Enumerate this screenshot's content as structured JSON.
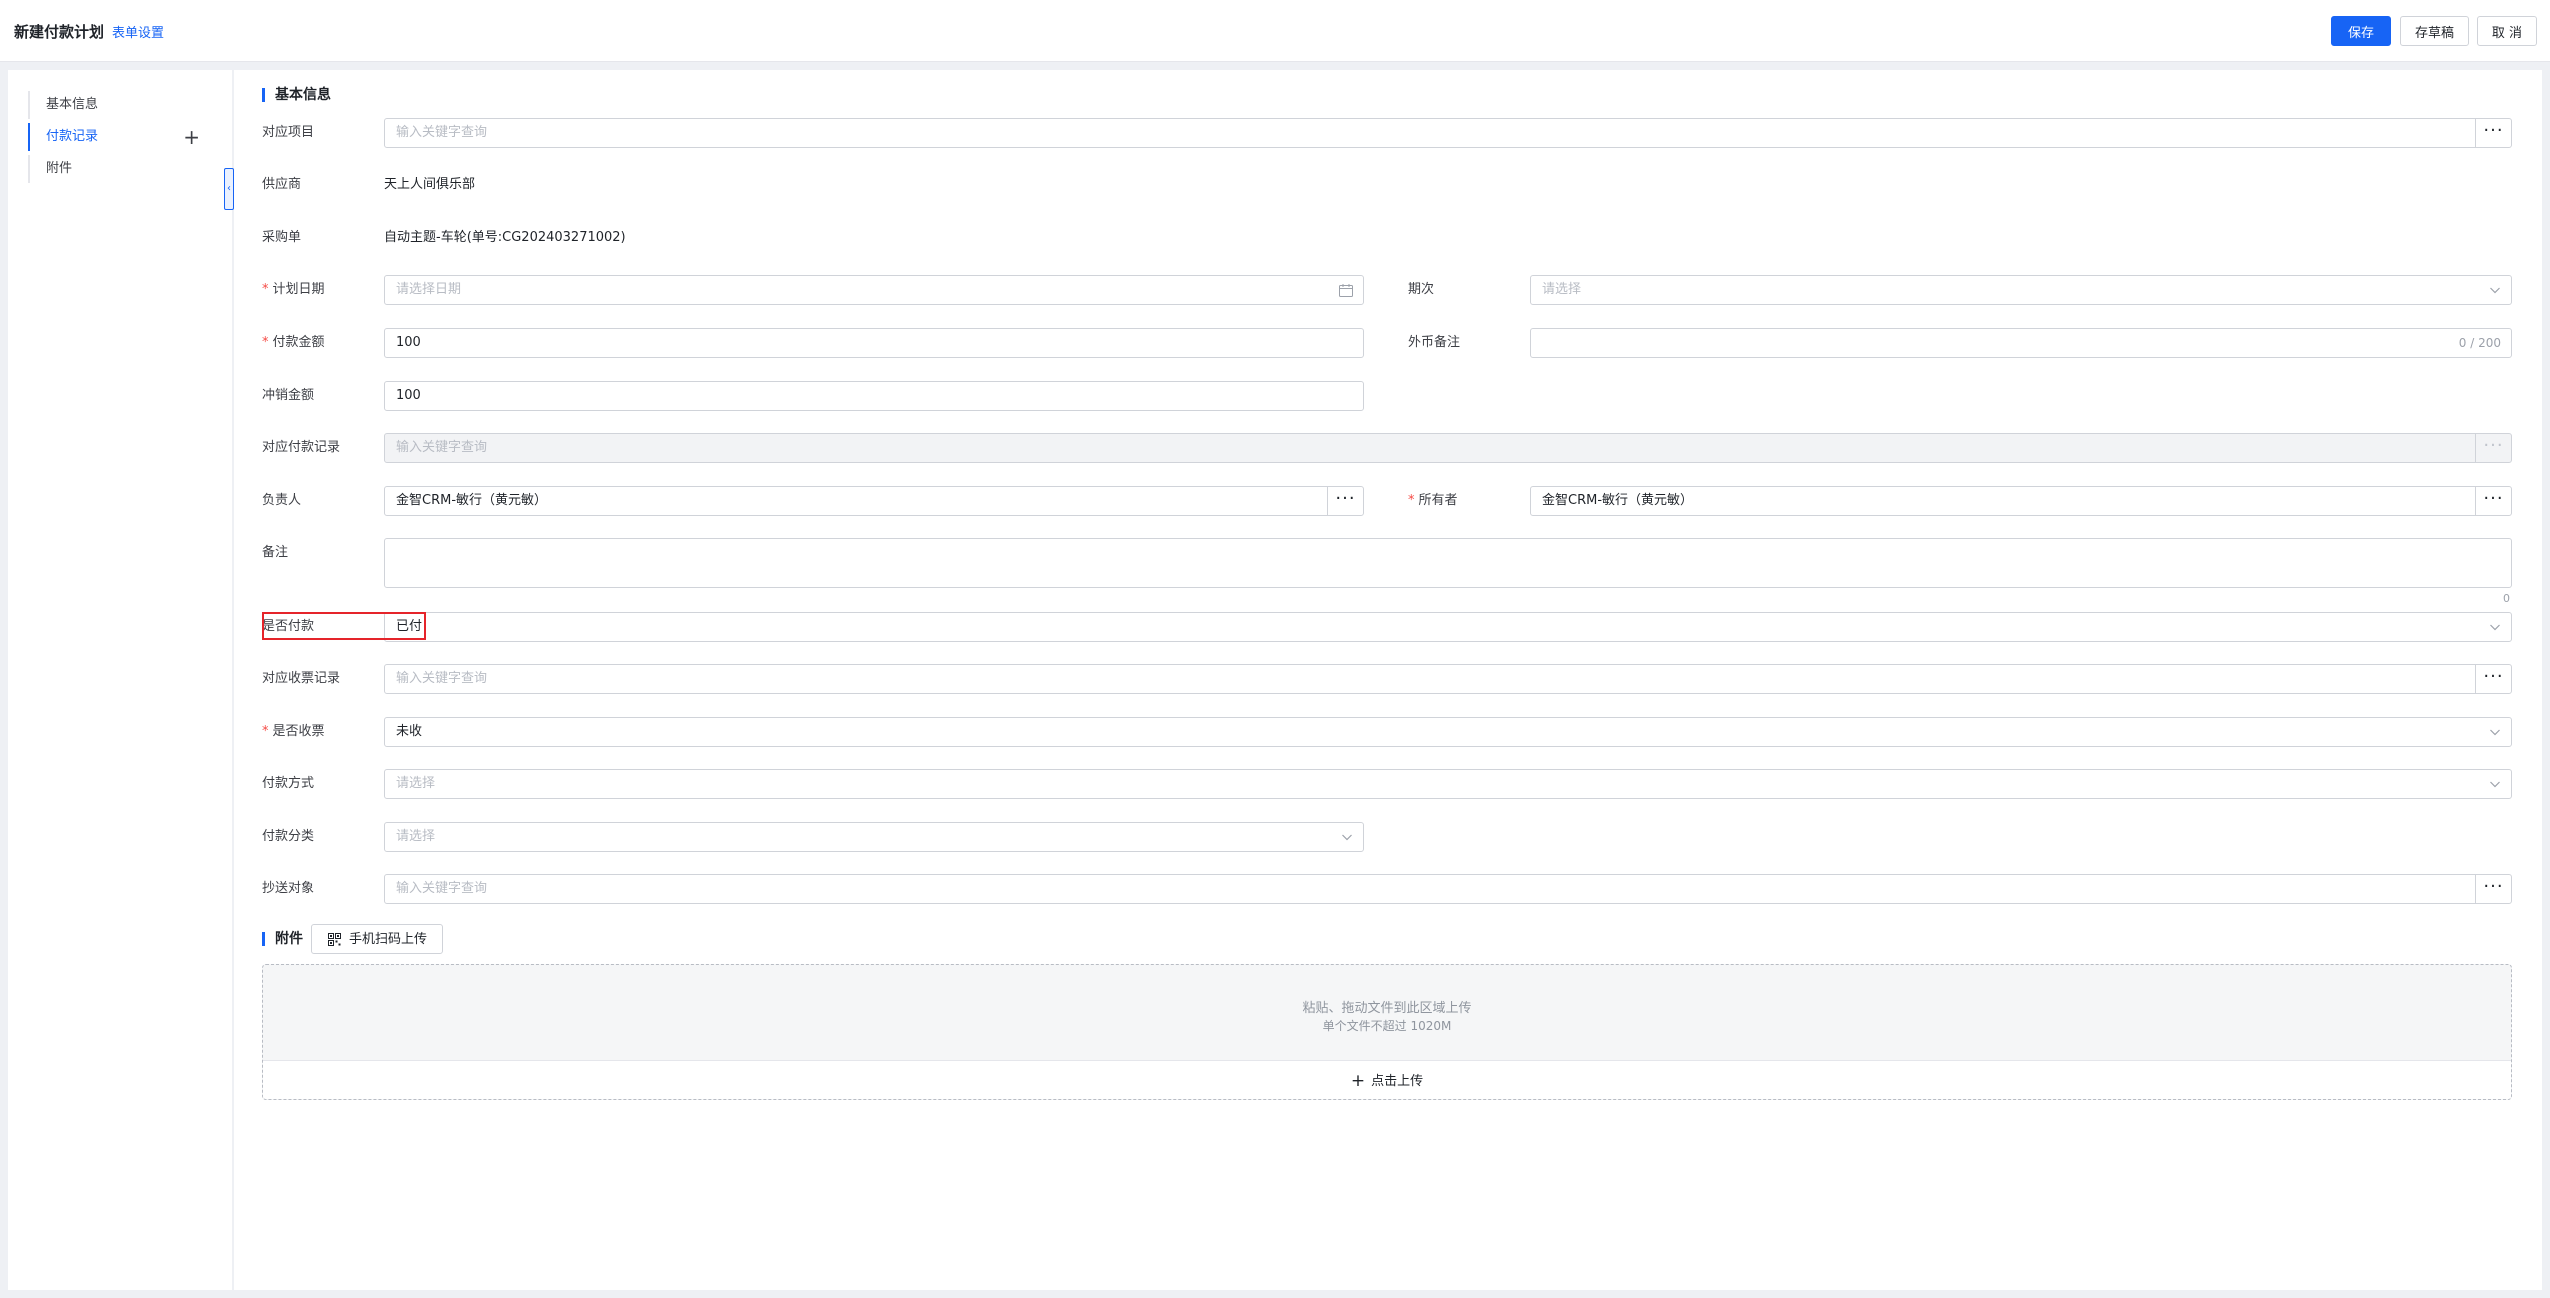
{
  "header": {
    "title": "新建付款计划",
    "form_settings": "表单设置",
    "save": "保存",
    "draft": "存草稿",
    "cancel": "取 消"
  },
  "sidebar": {
    "items": [
      {
        "label": "基本信息"
      },
      {
        "label": "付款记录"
      },
      {
        "label": "附件"
      }
    ],
    "active": "付款记录",
    "add_symbol": "+",
    "collapse_symbol": "‹"
  },
  "form": {
    "section_basic": "基本信息",
    "project": {
      "label": "对应项目",
      "placeholder": "输入关键字查询",
      "more": "···"
    },
    "supplier": {
      "label": "供应商",
      "value": "天上人间俱乐部"
    },
    "purchase_order": {
      "label": "采购单",
      "value": "自动主题-车轮(单号:CG202403271002)"
    },
    "plan_date": {
      "label": "计划日期",
      "required": "*",
      "placeholder": "请选择日期"
    },
    "period": {
      "label": "期次",
      "placeholder": "请选择"
    },
    "amount": {
      "label": "付款金额",
      "required": "*",
      "value": "100"
    },
    "foreign_note": {
      "label": "外币备注",
      "counter": "0 / 200"
    },
    "offset_amount": {
      "label": "冲销金额",
      "value": "100"
    },
    "payment_record": {
      "label": "对应付款记录",
      "placeholder": "输入关键字查询",
      "more": "···"
    },
    "manager": {
      "label": "负责人",
      "value": "金智CRM-敏行（黄元敏）",
      "more": "···"
    },
    "owner": {
      "label": "所有者",
      "required": "*",
      "value": "金智CRM-敏行（黄元敏）",
      "more": "···"
    },
    "remark": {
      "label": "备注",
      "counter": "0"
    },
    "is_paid": {
      "label": "是否付款",
      "value": "已付"
    },
    "invoice_record": {
      "label": "对应收票记录",
      "placeholder": "输入关键字查询",
      "more": "···"
    },
    "invoice_received": {
      "label": "是否收票",
      "required": "*",
      "value": "未收"
    },
    "pay_method": {
      "label": "付款方式",
      "placeholder": "请选择"
    },
    "pay_category": {
      "label": "付款分类",
      "placeholder": "请选择"
    },
    "cc": {
      "label": "抄送对象",
      "placeholder": "输入关键字查询",
      "more": "···"
    }
  },
  "attachments": {
    "section_title": "附件",
    "scan_upload": "手机扫码上传",
    "hint_drop": "粘贴、拖动文件到此区域上传",
    "hint_size": "单个文件不超过 1020M",
    "upload_plus": "+",
    "upload_label": "点击上传"
  },
  "colors": {
    "accent": "#1764f5",
    "required": "#f54a45",
    "highlight": "#e5242a"
  }
}
